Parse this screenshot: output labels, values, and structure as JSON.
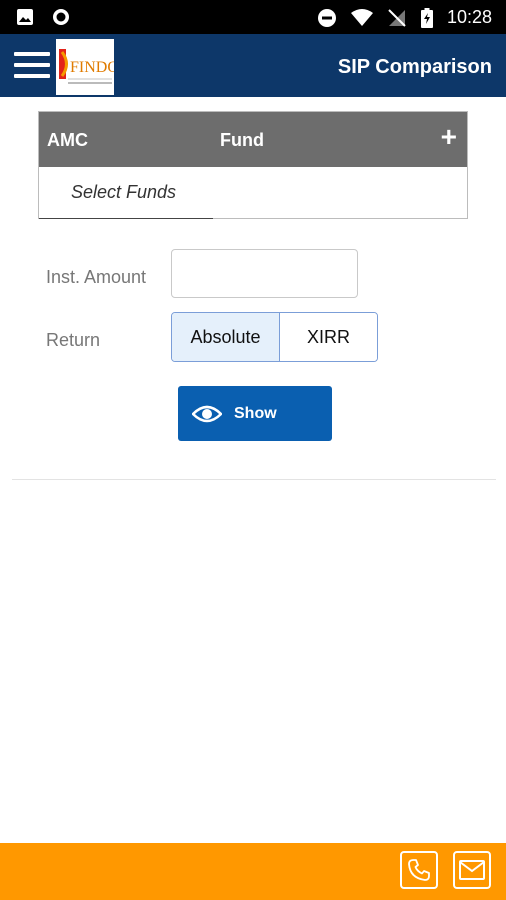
{
  "status_bar": {
    "time": "10:28"
  },
  "header": {
    "title": "SIP Comparison"
  },
  "fund_table": {
    "col_amc": "AMC",
    "col_fund": "Fund",
    "add_symbol": "+",
    "placeholder": "Select Funds"
  },
  "form": {
    "amount_label": "Inst. Amount",
    "amount_value": "",
    "return_label": "Return",
    "return_options": [
      "Absolute",
      "XIRR"
    ],
    "return_selected": "Absolute"
  },
  "show_button": {
    "label": "Show"
  },
  "colors": {
    "header": "#0d3769",
    "table_header": "#6d6d6d",
    "button": "#0a5fb0",
    "footer": "#ff9800",
    "selected_segment": "#e5f0fb"
  }
}
